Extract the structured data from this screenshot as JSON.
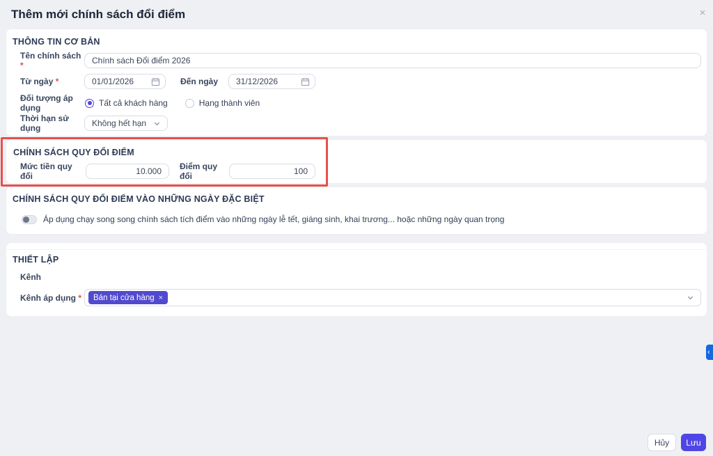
{
  "modal": {
    "title": "Thêm mới chính sách đổi điểm",
    "close_icon": "×"
  },
  "basic_info": {
    "header": "THÔNG TIN CƠ BẢN",
    "policy_name": {
      "label": "Tên chính sách",
      "required": "*",
      "value": "Chính sách Đổi điểm 2026"
    },
    "from_date": {
      "label": "Từ ngày",
      "required": "*",
      "value": "01/01/2026"
    },
    "to_date": {
      "label": "Đến ngày",
      "value": "31/12/2026"
    },
    "audience": {
      "label": "Đối tượng áp dụng",
      "options": [
        {
          "label": "Tất cả khách hàng",
          "selected": true
        },
        {
          "label": "Hạng thành viên",
          "selected": false
        }
      ]
    },
    "duration": {
      "label": "Thời hạn sử dụng",
      "value": "Không hết hạn"
    }
  },
  "conversion_policy": {
    "header": "CHÍNH SÁCH QUY ĐỔI ĐIỂM",
    "money_rate": {
      "label": "Mức tiền quy đổi",
      "value": "10.000"
    },
    "point_rate": {
      "label": "Điểm quy đổi",
      "value": "100"
    }
  },
  "special_days": {
    "header": "CHÍNH SÁCH QUY ĐỔI ĐIỂM VÀO NHỮNG NGÀY ĐẶC BIỆT",
    "toggle_on": false,
    "toggle_label": "Áp dụng chạy song song chính sách tích điểm vào những ngày lễ tết, giáng sinh, khai trương... hoặc những ngày quan trọng"
  },
  "settings": {
    "header": "THIẾT LẬP",
    "group_label": "Kênh",
    "channel": {
      "label": "Kênh áp dụng",
      "required": "*",
      "tags": [
        {
          "label": "Bán tại cửa hàng",
          "remove": "×"
        }
      ]
    }
  },
  "footer": {
    "cancel_label": "Hủy",
    "save_label": "Lưu"
  },
  "side_panel_toggle": "‹",
  "colors": {
    "accent": "#4f46e5",
    "highlight_box": "#e8504a",
    "side_button": "#1668dc"
  }
}
